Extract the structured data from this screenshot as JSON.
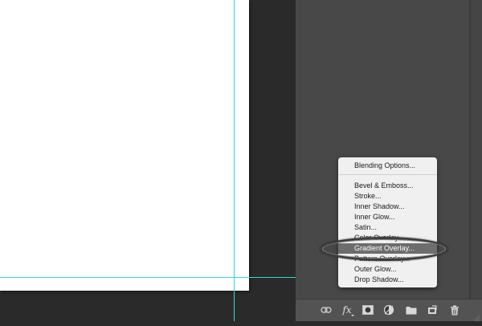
{
  "canvas": {
    "guide_color": "#34d7d9",
    "page_color": "#ffffff"
  },
  "layers_panel": {
    "background": "#484848",
    "bottom_bar": {
      "buttons": [
        {
          "name": "link-layers",
          "icon": "link-icon"
        },
        {
          "name": "add-layer-style",
          "label": "fx",
          "icon": "fx-icon"
        },
        {
          "name": "add-layer-mask",
          "icon": "mask-icon"
        },
        {
          "name": "new-fill-adjustment-layer",
          "icon": "half-circle-icon"
        },
        {
          "name": "new-group",
          "icon": "folder-icon"
        },
        {
          "name": "new-layer",
          "icon": "new-layer-icon"
        },
        {
          "name": "delete-layer",
          "icon": "trash-icon"
        }
      ]
    }
  },
  "fx_menu": {
    "items": [
      {
        "label": "Blending Options..."
      },
      {
        "label": "Bevel & Emboss..."
      },
      {
        "label": "Stroke..."
      },
      {
        "label": "Inner Shadow..."
      },
      {
        "label": "Inner Glow..."
      },
      {
        "label": "Satin..."
      },
      {
        "label": "Color Overlay..."
      },
      {
        "label": "Gradient Overlay..."
      },
      {
        "label": "Pattern Overlay..."
      },
      {
        "label": "Outer Glow..."
      },
      {
        "label": "Drop Shadow..."
      }
    ],
    "selected": "Gradient Overlay...",
    "selected_color": "#6d6d6d"
  }
}
